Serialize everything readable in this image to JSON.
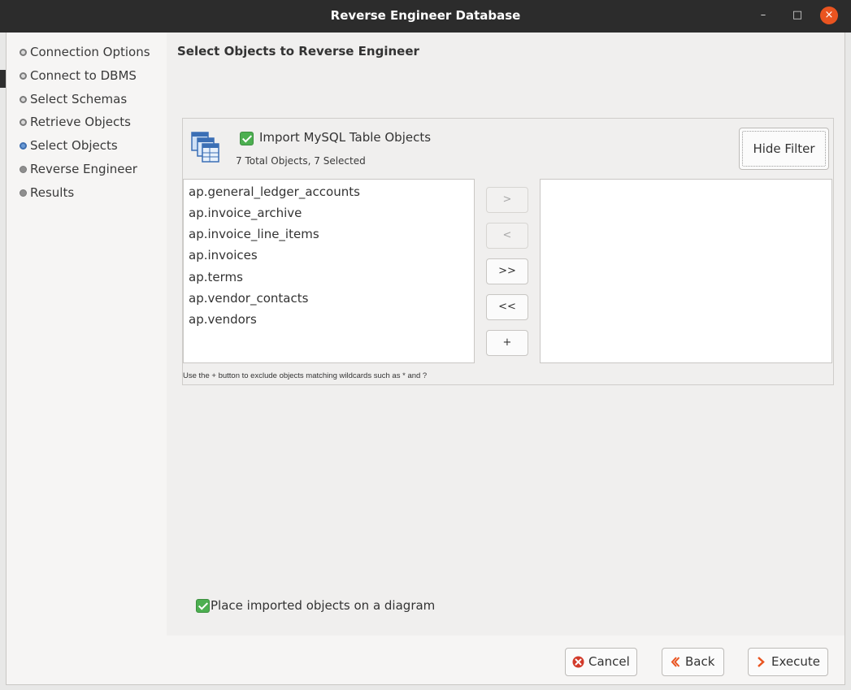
{
  "window": {
    "title": "Reverse Engineer Database",
    "controls": {
      "minimize": "–",
      "maximize": "□",
      "close": "×"
    }
  },
  "sidebar": {
    "steps": [
      {
        "label": "Connection Options",
        "state": "done"
      },
      {
        "label": "Connect to DBMS",
        "state": "done"
      },
      {
        "label": "Select Schemas",
        "state": "done"
      },
      {
        "label": "Retrieve Objects",
        "state": "done"
      },
      {
        "label": "Select Objects",
        "state": "current"
      },
      {
        "label": "Reverse Engineer",
        "state": "todo"
      },
      {
        "label": "Results",
        "state": "todo"
      }
    ]
  },
  "main": {
    "heading": "Select Objects to Reverse Engineer",
    "import_checkbox": {
      "label": "Import MySQL Table Objects",
      "checked": true
    },
    "summary": "7 Total Objects, 7 Selected",
    "hide_filter_label": "Hide Filter",
    "available_objects": [
      "ap.general_ledger_accounts",
      "ap.invoice_archive",
      "ap.invoice_line_items",
      "ap.invoices",
      "ap.terms",
      "ap.vendor_contacts",
      "ap.vendors"
    ],
    "excluded_objects": [],
    "move_buttons": {
      "move_right": ">",
      "move_left": "<",
      "move_all_right": ">>",
      "move_all_left": "<<",
      "add_filter": "+"
    },
    "hint": "Use the + button to exclude objects matching wildcards such as * and ?",
    "place_on_diagram": {
      "label": "Place imported objects on a diagram",
      "checked": true
    }
  },
  "footer": {
    "cancel_label": "Cancel",
    "back_label": "Back",
    "execute_label": "Execute"
  },
  "colors": {
    "titlebar": "#2c2c2c",
    "close_button": "#e95420",
    "checkbox": "#4caf50",
    "cancel_icon": "#d23a2a",
    "arrow_icon": "#e95420"
  }
}
